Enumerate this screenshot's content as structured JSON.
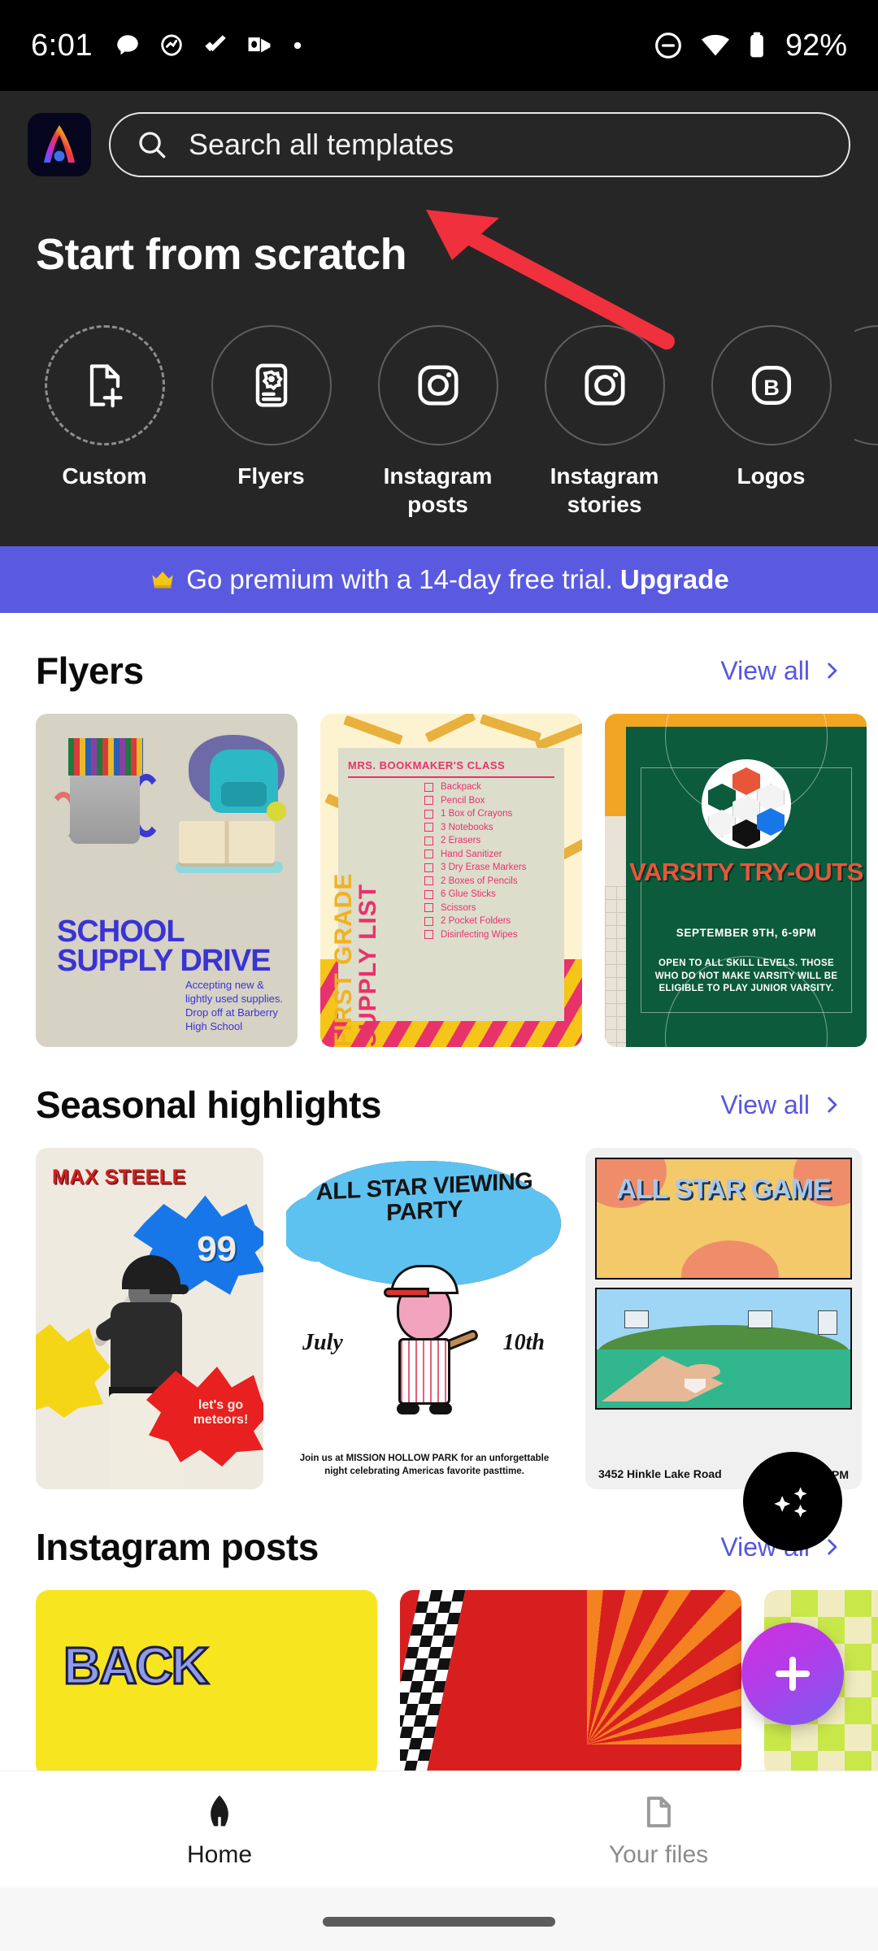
{
  "status_bar": {
    "time": "6:01",
    "battery_percent": "92%",
    "left_icons": [
      "chat-bubble-icon",
      "clock-app-icon",
      "checkmark-icon",
      "outlook-icon",
      "more-dot-icon"
    ],
    "right_icons": [
      "do-not-disturb-icon",
      "wifi-icon",
      "battery-icon"
    ]
  },
  "header": {
    "app_logo_name": "adobe-express-logo",
    "search_placeholder": "Search all templates",
    "search_value": "",
    "scratch_title": "Start from scratch"
  },
  "scratch_categories": [
    {
      "label": "Custom",
      "icon": "document-plus-icon",
      "style": "dashed"
    },
    {
      "label": "Flyers",
      "icon": "certificate-icon",
      "style": "solid"
    },
    {
      "label": "Instagram posts",
      "icon": "instagram-camera-icon",
      "style": "solid"
    },
    {
      "label": "Instagram stories",
      "icon": "instagram-camera-icon",
      "style": "solid"
    },
    {
      "label": "Logos",
      "icon": "logo-b-icon",
      "style": "solid"
    }
  ],
  "premium_banner": {
    "icon": "crown-icon",
    "text": "Go premium with a 14-day free trial.",
    "cta": "Upgrade",
    "background_color": "#5a5ae0"
  },
  "sections": [
    {
      "title": "Flyers",
      "view_all": "View all"
    },
    {
      "title": "Seasonal highlights",
      "view_all": "View all"
    },
    {
      "title": "Instagram posts",
      "view_all": "View all"
    }
  ],
  "flyer_cards": [
    {
      "name": "school-supply-drive",
      "title": "SCHOOL SUPPLY DRIVE",
      "subtitle": "Accepting new & lightly used supplies. Drop off at Barberry High School"
    },
    {
      "name": "first-grade-supply-list",
      "class_name": "MRS. BOOKMAKER'S CLASS",
      "title_part1": "FIRST GRADE",
      "title_part2": "SUPPLY LIST",
      "items": [
        "Backpack",
        "Pencil Box",
        "1 Box of Crayons",
        "3 Notebooks",
        "2 Erasers",
        "Hand Sanitizer",
        "3 Dry Erase Markers",
        "2 Boxes of Pencils",
        "6 Glue Sticks",
        "Scissors",
        "2 Pocket Folders",
        "Disinfecting Wipes"
      ]
    },
    {
      "name": "varsity-try-outs",
      "title": "VARSITY TRY-OUTS",
      "date": "SEPTEMBER 9TH, 6-9PM",
      "body": "OPEN TO ALL SKILL LEVELS. THOSE WHO DO NOT MAKE VARSITY WILL BE ELIGIBLE TO PLAY JUNIOR VARSITY."
    }
  ],
  "seasonal_cards": [
    {
      "name": "max-steele-poster",
      "title": "MAX STEELE",
      "number": "99",
      "tagline": "let's go meteors!"
    },
    {
      "name": "all-star-viewing-party",
      "title": "ALL STAR VIEWING PARTY",
      "month": "July",
      "day": "10th",
      "note": "Join us at MISSION HOLLOW PARK for an unforgettable night celebrating Americas favorite pasttime."
    },
    {
      "name": "all-star-game",
      "title": "ALL STAR GAME",
      "address": "3452 Hinkle Lake Road",
      "time": "PM"
    }
  ],
  "instagram_cards": [
    {
      "name": "back-to-school-post",
      "text": "BACK"
    },
    {
      "name": "red-rays-post",
      "text": ""
    },
    {
      "name": "green-checker-post",
      "text": ""
    }
  ],
  "fabs": [
    {
      "name": "ai-sparkle-fab",
      "icon": "sparkles-icon",
      "color": "#000000"
    },
    {
      "name": "create-fab",
      "icon": "plus-icon",
      "color": "#b43ce8"
    }
  ],
  "bottom_nav": [
    {
      "label": "Home",
      "icon": "home-icon",
      "active": true
    },
    {
      "label": "Your files",
      "icon": "file-icon",
      "active": false
    }
  ],
  "annotation": {
    "type": "red-arrow",
    "color": "#f0303c",
    "points_to": "search-input"
  }
}
